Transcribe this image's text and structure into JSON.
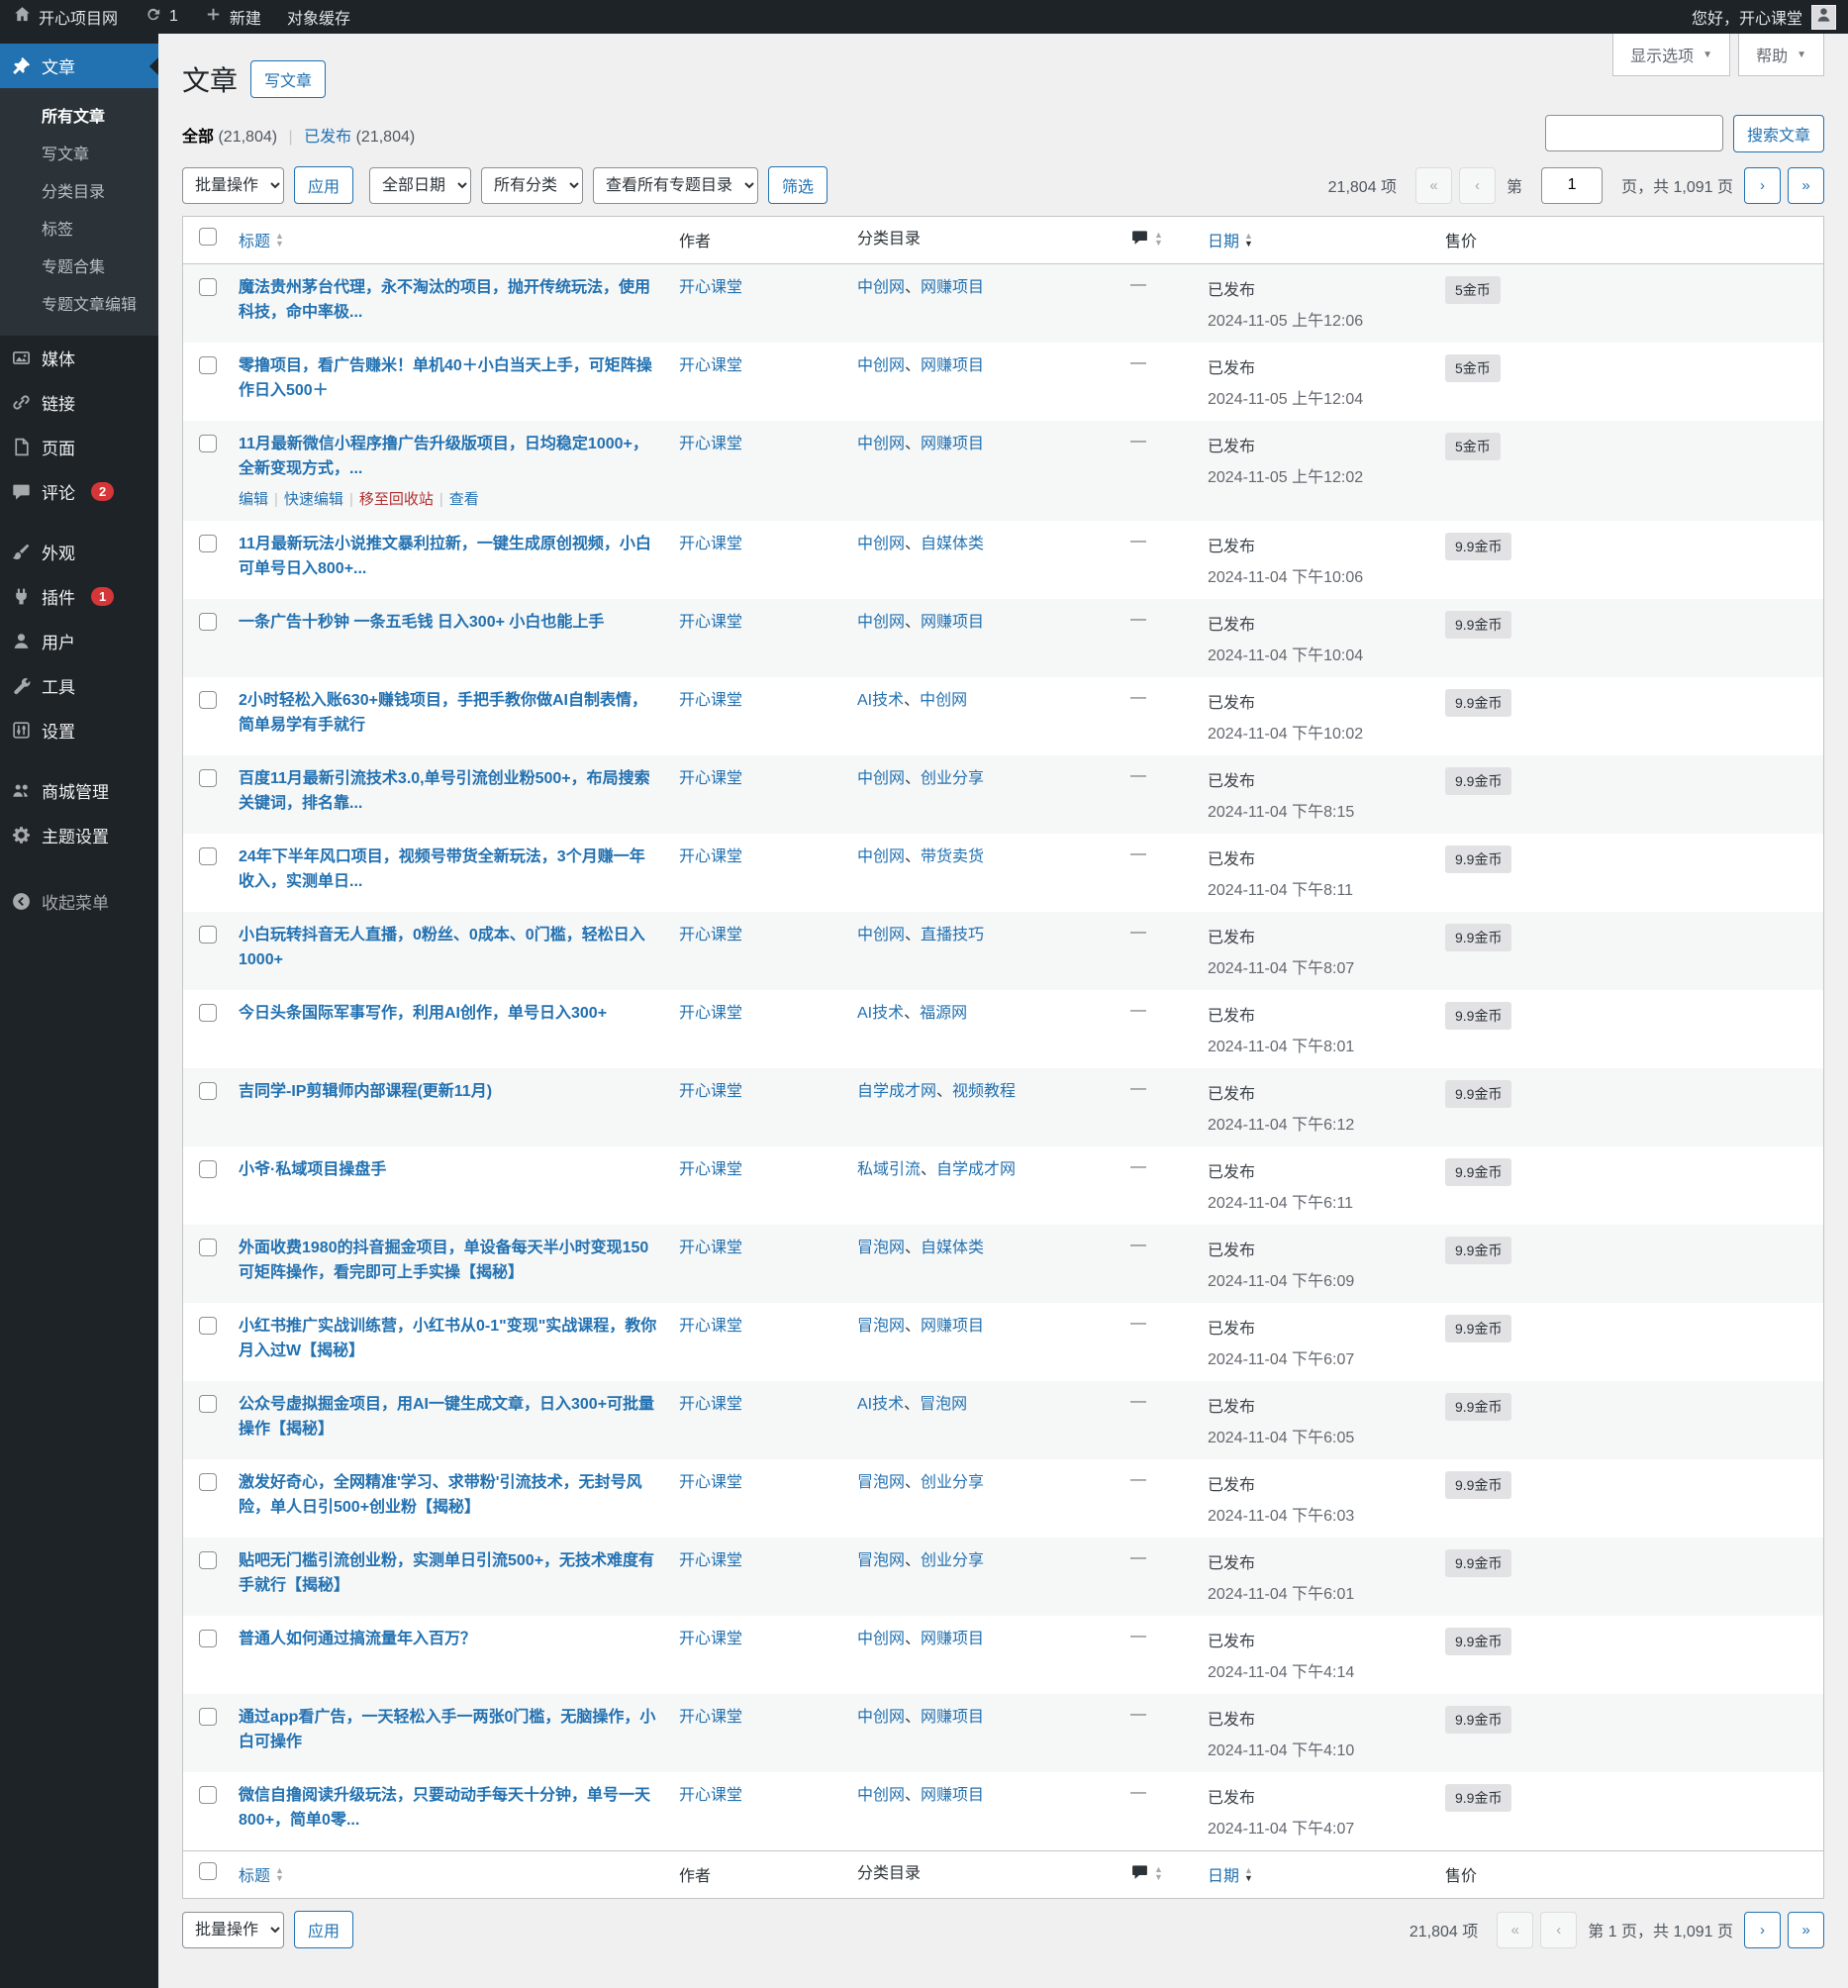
{
  "admin_bar": {
    "site_name": "开心项目网",
    "updates_count": "1",
    "new_label": "新建",
    "object_cache_label": "对象缓存",
    "greeting": "您好，开心课堂"
  },
  "sidebar": {
    "posts": {
      "label": "文章",
      "submenu": [
        {
          "label": "所有文章",
          "current": true
        },
        {
          "label": "写文章"
        },
        {
          "label": "分类目录"
        },
        {
          "label": "标签"
        },
        {
          "label": "专题合集"
        },
        {
          "label": "专题文章编辑"
        }
      ]
    },
    "items": [
      {
        "label": "媒体",
        "icon": "media"
      },
      {
        "label": "链接",
        "icon": "link"
      },
      {
        "label": "页面",
        "icon": "pages"
      },
      {
        "label": "评论",
        "icon": "comments",
        "badge": "2"
      },
      {
        "label": "外观",
        "icon": "appearance",
        "gap_before": true
      },
      {
        "label": "插件",
        "icon": "plugins",
        "badge": "1"
      },
      {
        "label": "用户",
        "icon": "users"
      },
      {
        "label": "工具",
        "icon": "tools"
      },
      {
        "label": "设置",
        "icon": "settings"
      },
      {
        "label": "商城管理",
        "icon": "shop",
        "gap_before": true
      },
      {
        "label": "主题设置",
        "icon": "theme"
      }
    ],
    "collapse_label": "收起菜单"
  },
  "page": {
    "title": "文章",
    "add_new_label": "写文章",
    "screen_options_label": "显示选项",
    "help_label": "帮助",
    "views": {
      "all_label": "全部",
      "all_count": "(21,804)",
      "published_label": "已发布",
      "published_count": "(21,804)"
    },
    "search_button": "搜索文章"
  },
  "toolbar": {
    "bulk_action_label": "批量操作",
    "apply_label": "应用",
    "dates_label": "全部日期",
    "categories_label": "所有分类",
    "topics_label": "查看所有专题目录",
    "filter_label": "筛选"
  },
  "pagination": {
    "total_items": "21,804 项",
    "first": "«",
    "prev": "‹",
    "next": "›",
    "last": "»",
    "page_prefix": "第",
    "current_page": "1",
    "page_suffix": "页，共 1,091 页",
    "bottom_current": "第 1 页，共 1,091 页"
  },
  "table": {
    "headers": {
      "title": "标题",
      "author": "作者",
      "categories": "分类目录",
      "date": "日期",
      "price": "售价"
    },
    "row_actions": {
      "edit": "编辑",
      "quick_edit": "快速编辑",
      "trash": "移至回收站",
      "view": "查看"
    },
    "status_published": "已发布",
    "no_comments": "—",
    "rows": [
      {
        "title": "魔法贵州茅台代理，永不淘汰的项目，抛开传统玩法，使用科技，命中率极...",
        "author": "开心课堂",
        "categories": [
          "中创网",
          "网赚项目"
        ],
        "date": "2024-11-05 上午12:06",
        "price": "5金币"
      },
      {
        "title": "零撸项目，看广告赚米！单机40＋小白当天上手，可矩阵操作日入500＋",
        "author": "开心课堂",
        "categories": [
          "中创网",
          "网赚项目"
        ],
        "date": "2024-11-05 上午12:04",
        "price": "5金币"
      },
      {
        "title": "11月最新微信小程序撸广告升级版项目，日均稳定1000+，全新变现方式，...",
        "author": "开心课堂",
        "categories": [
          "中创网",
          "网赚项目"
        ],
        "date": "2024-11-05 上午12:02",
        "price": "5金币",
        "show_actions": true
      },
      {
        "title": "11月最新玩法小说推文暴利拉新，一键生成原创视频，小白可单号日入800+...",
        "author": "开心课堂",
        "categories": [
          "中创网",
          "自媒体类"
        ],
        "date": "2024-11-04 下午10:06",
        "price": "9.9金币"
      },
      {
        "title": "一条广告十秒钟 一条五毛钱 日入300+ 小白也能上手",
        "author": "开心课堂",
        "categories": [
          "中创网",
          "网赚项目"
        ],
        "date": "2024-11-04 下午10:04",
        "price": "9.9金币"
      },
      {
        "title": "2小时轻松入账630+赚钱项目，手把手教你做AI自制表情，简单易学有手就行",
        "author": "开心课堂",
        "categories": [
          "AI技术",
          "中创网"
        ],
        "date": "2024-11-04 下午10:02",
        "price": "9.9金币"
      },
      {
        "title": "百度11月最新引流技术3.0,单号引流创业粉500+，布局搜索关键词，排名靠...",
        "author": "开心课堂",
        "categories": [
          "中创网",
          "创业分享"
        ],
        "date": "2024-11-04 下午8:15",
        "price": "9.9金币"
      },
      {
        "title": "24年下半年风口项目，视频号带货全新玩法，3个月赚一年收入，实测单日...",
        "author": "开心课堂",
        "categories": [
          "中创网",
          "带货卖货"
        ],
        "date": "2024-11-04 下午8:11",
        "price": "9.9金币"
      },
      {
        "title": "小白玩转抖音无人直播，0粉丝、0成本、0门槛，轻松日入1000+",
        "author": "开心课堂",
        "categories": [
          "中创网",
          "直播技巧"
        ],
        "date": "2024-11-04 下午8:07",
        "price": "9.9金币"
      },
      {
        "title": "今日头条国际军事写作，利用AI创作，单号日入300+",
        "author": "开心课堂",
        "categories": [
          "AI技术",
          "福源网"
        ],
        "date": "2024-11-04 下午8:01",
        "price": "9.9金币"
      },
      {
        "title": "吉同学-IP剪辑师内部课程(更新11月)",
        "author": "开心课堂",
        "categories": [
          "自学成才网",
          "视频教程"
        ],
        "date": "2024-11-04 下午6:12",
        "price": "9.9金币"
      },
      {
        "title": "小爷·私域项目操盘手",
        "author": "开心课堂",
        "categories": [
          "私域引流",
          "自学成才网"
        ],
        "date": "2024-11-04 下午6:11",
        "price": "9.9金币"
      },
      {
        "title": "外面收费1980的抖音掘金项目，单设备每天半小时变现150可矩阵操作，看完即可上手实操【揭秘】",
        "author": "开心课堂",
        "categories": [
          "冒泡网",
          "自媒体类"
        ],
        "date": "2024-11-04 下午6:09",
        "price": "9.9金币"
      },
      {
        "title": "小红书推广实战训练营，小红书从0-1\"变现\"实战课程，教你月入过W【揭秘】",
        "author": "开心课堂",
        "categories": [
          "冒泡网",
          "网赚项目"
        ],
        "date": "2024-11-04 下午6:07",
        "price": "9.9金币"
      },
      {
        "title": "公众号虚拟掘金项目，用AI一键生成文章，日入300+可批量操作【揭秘】",
        "author": "开心课堂",
        "categories": [
          "AI技术",
          "冒泡网"
        ],
        "date": "2024-11-04 下午6:05",
        "price": "9.9金币"
      },
      {
        "title": "激发好奇心，全网精准'学习、求带粉'引流技术，无封号风险，单人日引500+创业粉【揭秘】",
        "author": "开心课堂",
        "categories": [
          "冒泡网",
          "创业分享"
        ],
        "date": "2024-11-04 下午6:03",
        "price": "9.9金币"
      },
      {
        "title": "贴吧无门槛引流创业粉，实测单日引流500+，无技术难度有手就行【揭秘】",
        "author": "开心课堂",
        "categories": [
          "冒泡网",
          "创业分享"
        ],
        "date": "2024-11-04 下午6:01",
        "price": "9.9金币"
      },
      {
        "title": "普通人如何通过搞流量年入百万？",
        "author": "开心课堂",
        "categories": [
          "中创网",
          "网赚项目"
        ],
        "date": "2024-11-04 下午4:14",
        "price": "9.9金币"
      },
      {
        "title": "通过app看广告，一天轻松入手一两张0门槛，无脑操作，小白可操作",
        "author": "开心课堂",
        "categories": [
          "中创网",
          "网赚项目"
        ],
        "date": "2024-11-04 下午4:10",
        "price": "9.9金币"
      },
      {
        "title": "微信自撸阅读升级玩法，只要动动手每天十分钟，单号一天800+，简单0零...",
        "author": "开心课堂",
        "categories": [
          "中创网",
          "网赚项目"
        ],
        "date": "2024-11-04 下午4:07",
        "price": "9.9金币"
      }
    ]
  },
  "colors": {
    "accent": "#2271b1",
    "admin_bar_bg": "#1d2327",
    "badge_red": "#d63638",
    "trash_red": "#b32d2e",
    "content_bg": "#f0f0f1"
  }
}
